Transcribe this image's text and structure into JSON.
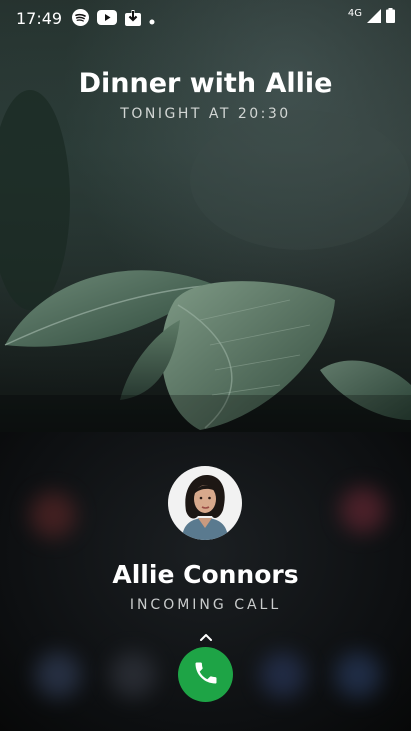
{
  "status_bar": {
    "time": "17:49",
    "network": "4G",
    "icons": [
      "spotify-icon",
      "youtube-icon",
      "download-icon",
      "notification-dot-icon",
      "signal-icon",
      "battery-icon"
    ]
  },
  "event": {
    "title": "Dinner with Allie",
    "subtitle": "TONIGHT AT 20:30"
  },
  "call": {
    "caller_name": "Allie Connors",
    "status": "INCOMING CALL",
    "answer_color": "#1ea446"
  }
}
